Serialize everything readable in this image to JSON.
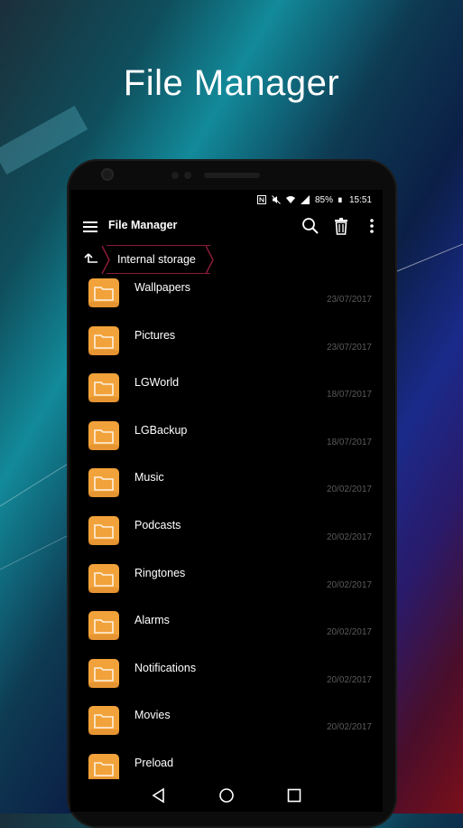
{
  "headline": "File Manager",
  "status_bar": {
    "battery": "85%",
    "time": "15:51",
    "icons": [
      "nfc-icon",
      "mute-icon",
      "wifi-icon",
      "signal-icon",
      "battery-icon"
    ]
  },
  "app_bar": {
    "title": "File Manager",
    "icons": [
      "menu-icon",
      "search-icon",
      "trash-icon",
      "more-icon"
    ]
  },
  "breadcrumb": {
    "up_icon": "up-arrow-icon",
    "current": "Internal storage"
  },
  "files": [
    {
      "name": "Wallpapers",
      "date": "23/07/2017"
    },
    {
      "name": "Pictures",
      "date": "23/07/2017"
    },
    {
      "name": "LGWorld",
      "date": "18/07/2017"
    },
    {
      "name": "LGBackup",
      "date": "18/07/2017"
    },
    {
      "name": "Music",
      "date": "20/02/2017"
    },
    {
      "name": "Podcasts",
      "date": "20/02/2017"
    },
    {
      "name": "Ringtones",
      "date": "20/02/2017"
    },
    {
      "name": "Alarms",
      "date": "20/02/2017"
    },
    {
      "name": "Notifications",
      "date": "20/02/2017"
    },
    {
      "name": "Movies",
      "date": "20/02/2017"
    },
    {
      "name": "Preload",
      "date": ""
    }
  ],
  "nav_bar": [
    "back-icon",
    "home-icon",
    "recents-icon"
  ],
  "colors": {
    "folder": "#f2a23a",
    "folder_dark": "#d9872a",
    "breadcrumb_border": "#8a1b36",
    "date_text": "#5a5a5a"
  }
}
